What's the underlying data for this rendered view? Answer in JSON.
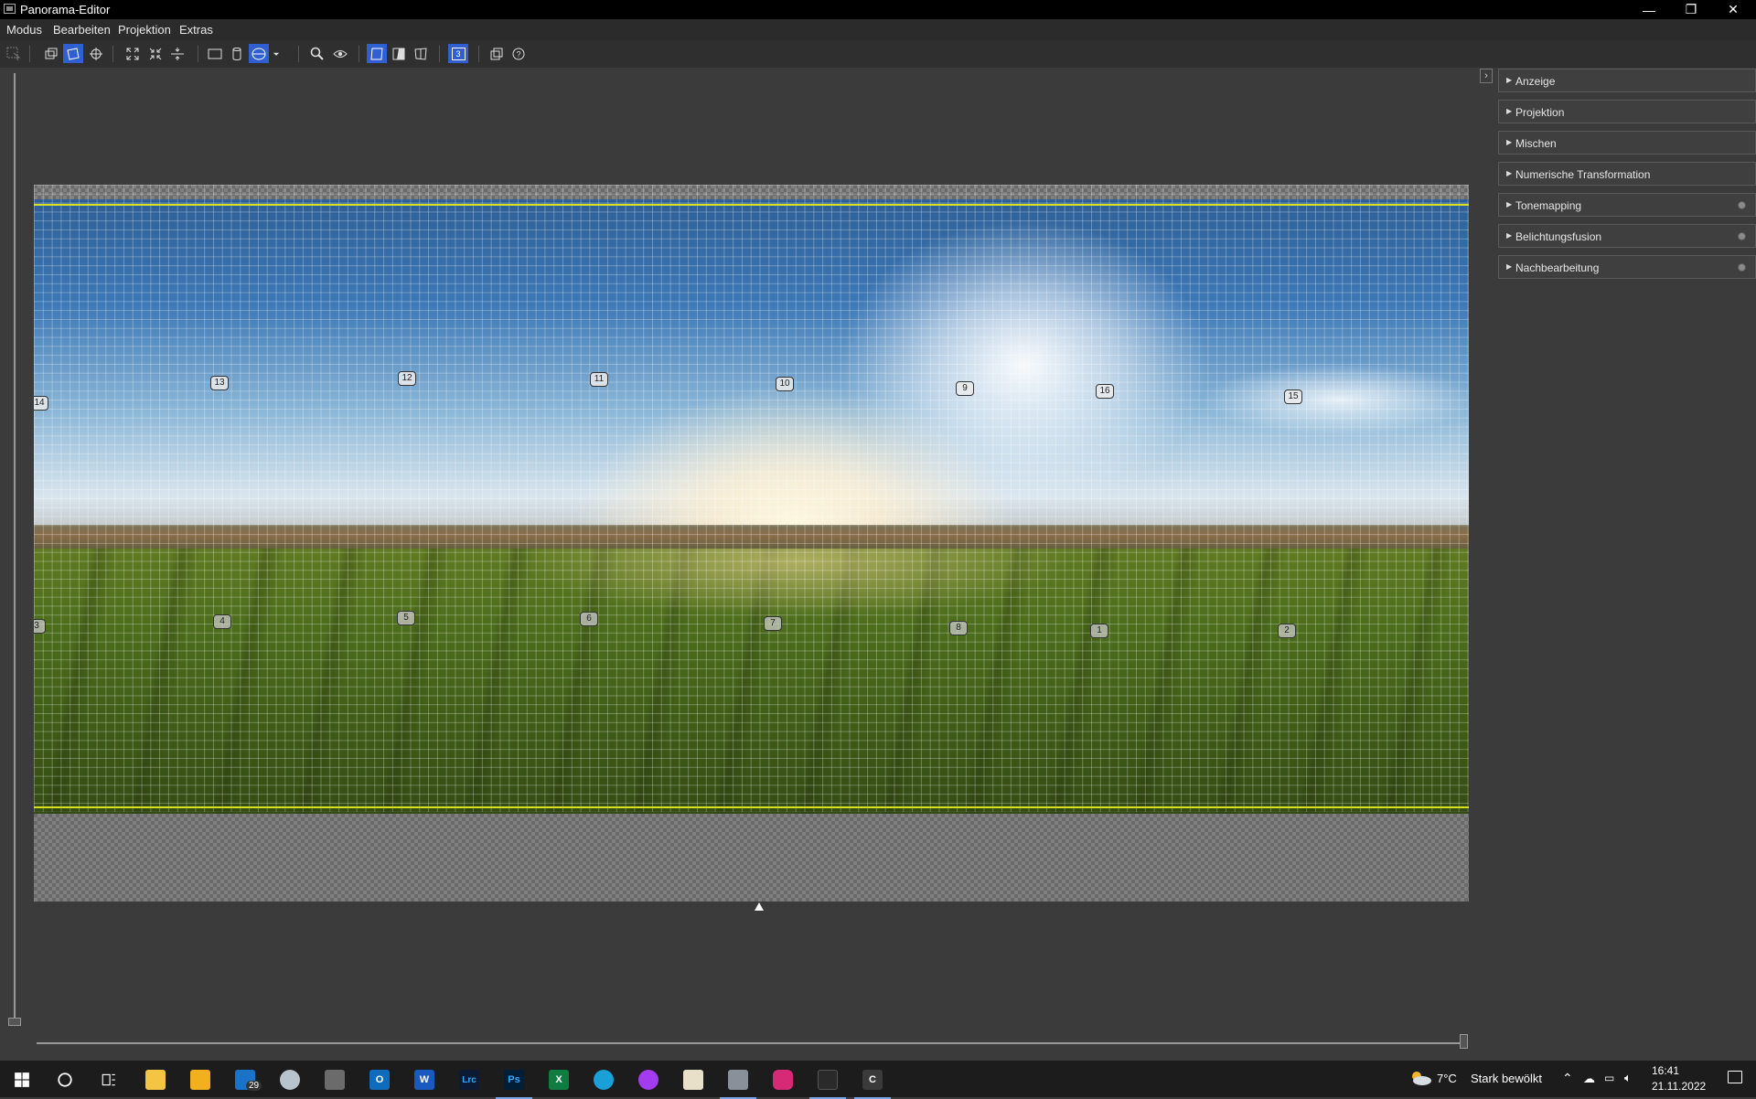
{
  "window": {
    "title": "Panorama-Editor",
    "minimize_glyph": "—",
    "restore_glyph": "❐",
    "close_glyph": "✕"
  },
  "menu": [
    "Modus",
    "Bearbeiten",
    "Projektion",
    "Extras"
  ],
  "toolbar": {
    "buttons": [
      {
        "name": "select-tool-icon",
        "active": false
      },
      {
        "name": "move-image-icon",
        "active": false
      },
      {
        "name": "drag-pano-icon",
        "active": true
      },
      {
        "name": "identify-crosshair-icon",
        "active": false
      },
      {
        "name": "fit-to-view-icon",
        "active": false
      },
      {
        "name": "center-pano-icon",
        "active": false
      },
      {
        "name": "straighten-horizon-icon",
        "active": false
      },
      {
        "name": "rectilinear-projection-icon",
        "active": false
      },
      {
        "name": "cylindrical-projection-icon",
        "active": false
      },
      {
        "name": "equirectangular-projection-icon",
        "active": true
      },
      {
        "name": "projection-dropdown-icon",
        "active": false
      },
      {
        "name": "zoom-icon",
        "active": false
      },
      {
        "name": "preview-eye-icon",
        "active": false
      },
      {
        "name": "normal-view-icon",
        "active": true
      },
      {
        "name": "difference-view-icon",
        "active": false
      },
      {
        "name": "mosaic-view-icon",
        "active": false
      },
      {
        "name": "layer-number-icon",
        "active": true
      },
      {
        "name": "overview-window-icon",
        "active": false
      },
      {
        "name": "help-icon",
        "active": false
      }
    ],
    "layer_number": "3"
  },
  "panel": {
    "toggle_glyph": "›",
    "sections": [
      {
        "label": "Anzeige",
        "indicator": false
      },
      {
        "label": "Projektion",
        "indicator": false
      },
      {
        "label": "Mischen",
        "indicator": false
      },
      {
        "label": "Numerische Transformation",
        "indicator": false
      },
      {
        "label": "Tonemapping",
        "indicator": true
      },
      {
        "label": "Belichtungsfusion",
        "indicator": true
      },
      {
        "label": "Nachbearbeitung",
        "indicator": true
      }
    ]
  },
  "control_points": {
    "upper": [
      "14",
      "13",
      "12",
      "11",
      "10",
      "9",
      "16",
      "15"
    ],
    "lower": [
      "3",
      "4",
      "5",
      "6",
      "7",
      "8",
      "1",
      "2"
    ]
  },
  "taskbar": {
    "apps": [
      {
        "name": "file-explorer-icon",
        "label": "",
        "color": "#f4c542"
      },
      {
        "name": "store-icon",
        "label": "",
        "color": "#f2b01e"
      },
      {
        "name": "mail-icon",
        "label": "",
        "color": "#1b73c9",
        "badge": "29"
      },
      {
        "name": "cloud-app-icon",
        "label": "",
        "color": "#b9c3cc"
      },
      {
        "name": "calculator-icon",
        "label": "",
        "color": "#6b6b6b"
      },
      {
        "name": "outlook-icon",
        "label": "O",
        "color": "#0f6cbd"
      },
      {
        "name": "word-icon",
        "label": "W",
        "color": "#185abd"
      },
      {
        "name": "lightroom-classic-icon",
        "label": "Lrc",
        "color": "#0c1b33"
      },
      {
        "name": "photoshop-icon",
        "label": "Ps",
        "color": "#001e36"
      },
      {
        "name": "excel-icon",
        "label": "X",
        "color": "#107c41"
      },
      {
        "name": "edge-icon",
        "label": "",
        "color": "#1aa0d8"
      },
      {
        "name": "messenger-icon",
        "label": "",
        "color": "#a33bf0"
      },
      {
        "name": "app-brush-icon",
        "label": "",
        "color": "#e8e0c8"
      },
      {
        "name": "panorama-editor-icon",
        "label": "",
        "color": "#8a9099"
      },
      {
        "name": "instagram-icon",
        "label": "",
        "color": "#d62976"
      },
      {
        "name": "app-dark-icon",
        "label": "",
        "color": "#2a2a2a"
      },
      {
        "name": "app-c-icon",
        "label": "C",
        "color": "#3a3a3a"
      }
    ],
    "weather_temp": "7°C",
    "weather_text": "Stark bewölkt",
    "time": "16:41",
    "date": "21.11.2022"
  },
  "colors": {
    "active_button": "#2f5fd0",
    "limit_line": "#d8e020"
  }
}
